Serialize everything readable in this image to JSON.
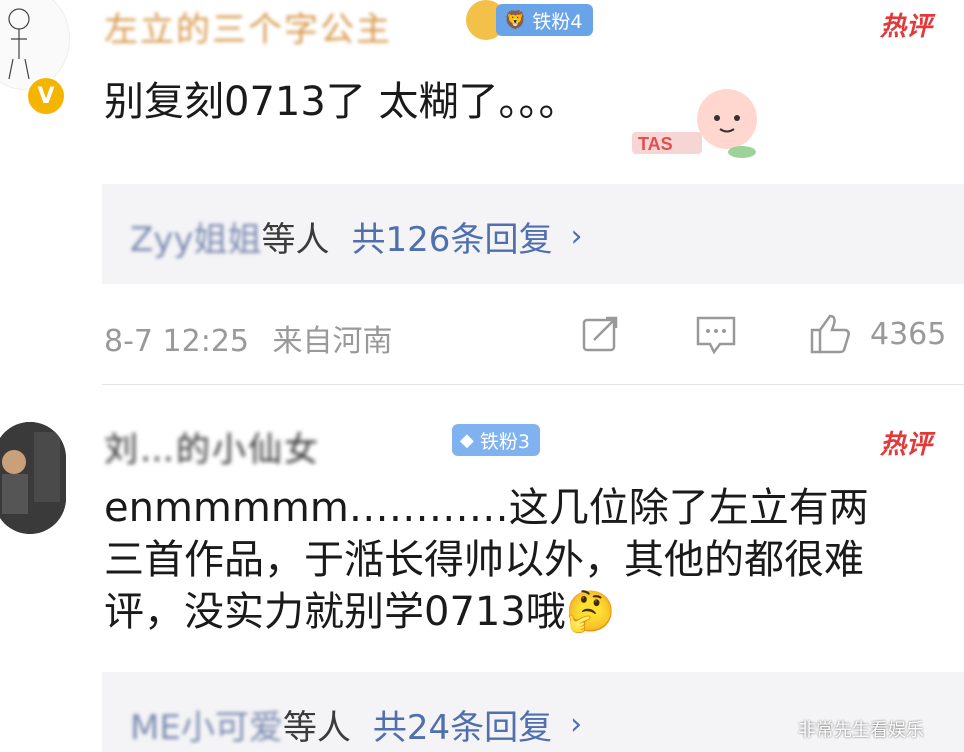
{
  "comments": [
    {
      "author_name": "左立的三个字公主",
      "fan_badge": "铁粉4",
      "hot_label": "热评",
      "text": "别复刻0713了 太糊了。。。",
      "sticker_text": "TAS",
      "replies": {
        "names": "Zyy姐姐",
        "sep": "等人",
        "count": "共126条回复",
        "chevron": "›"
      },
      "time": "8-7 12:25",
      "location": "来自河南",
      "likes": "4365"
    },
    {
      "author_name": "刘…的小仙女",
      "fan_badge": "铁粉3",
      "hot_label": "热评",
      "text_line1": "enmmmmm…………这几位除了左立有两",
      "text_line2": "三首作品，于湉长得帅以外，其他的都很难",
      "text_line3": "评，没实力就别学0713哦🤔",
      "replies": {
        "names": "ME小可爱",
        "sep": "等人",
        "count": "共24条回复",
        "chevron": "›"
      }
    }
  ],
  "watermark": "非常先生看娱乐",
  "icons": {
    "verified": "V",
    "gold_badge_icon": "🦁",
    "diamond_badge_icon": "◆"
  }
}
